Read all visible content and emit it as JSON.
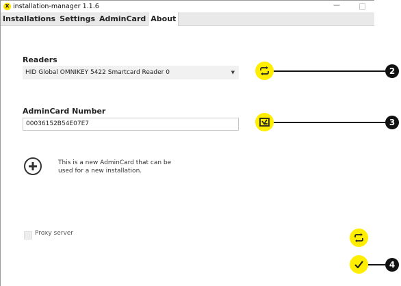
{
  "window": {
    "title": "installation-manager 1.1.6",
    "minimize_glyph": "—",
    "app_icon": "x"
  },
  "tabs": [
    {
      "label": "Installations",
      "active": false
    },
    {
      "label": "Settings",
      "active": false
    },
    {
      "label": "AdminCard",
      "active": true
    },
    {
      "label": "About",
      "active": false
    }
  ],
  "readers": {
    "label": "Readers",
    "selected": "HID Global OMNIKEY 5422 Smartcard Reader 0",
    "caret": "▼",
    "refresh_icon": "refresh-icon"
  },
  "admincard": {
    "label": "AdminCard Number",
    "value": "00036152B54E07E7",
    "read_icon": "card-import-icon"
  },
  "new_card": {
    "icon": "plus-icon",
    "text": "This is a new AdminCard that can be used for a new installation."
  },
  "proxy": {
    "label": "Proxy server",
    "checked": false
  },
  "callouts": [
    "2",
    "3",
    "4"
  ],
  "colors": {
    "accent_yellow": "#ffee00",
    "callout": "#111111"
  }
}
